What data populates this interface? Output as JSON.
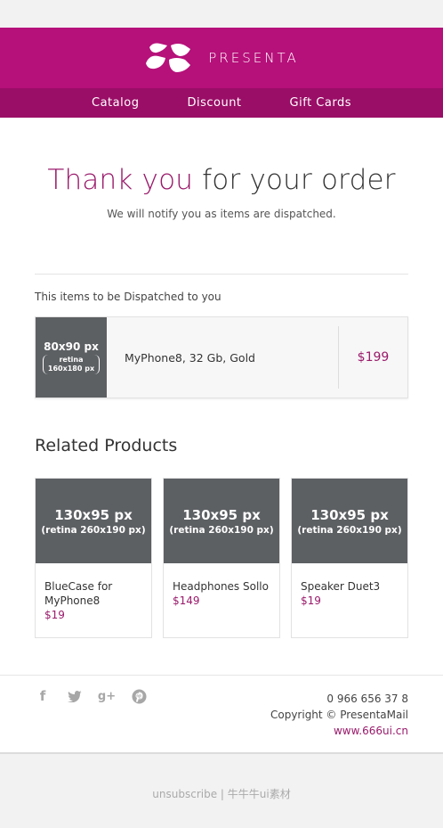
{
  "brand": {
    "name": "PRESENTA"
  },
  "nav": [
    "Catalog",
    "Discount",
    "Gift Cards"
  ],
  "hero": {
    "title_accent": "Thank you",
    "title_rest": " for your order",
    "subtitle": "We will notify you as items are dispatched."
  },
  "dispatch": {
    "title": "This items to be Dispatched to you",
    "item": {
      "thumb_big": "80x90 px",
      "thumb_small_1": "retina",
      "thumb_small_2": "160x180 px",
      "name": "MyPhone8, 32 Gb, Gold",
      "price": "$199"
    }
  },
  "related": {
    "title": "Related Products",
    "products": [
      {
        "img_big": "130x95 px",
        "img_small": "(retina 260x190 px)",
        "name": "BlueCase for MyPhone8",
        "price": "$19"
      },
      {
        "img_big": "130x95 px",
        "img_small": "(retina 260x190 px)",
        "name": "Headphones Sollo",
        "price": "$149"
      },
      {
        "img_big": "130x95 px",
        "img_small": "(retina 260x190 px)",
        "name": "Speaker Duet3",
        "price": "$19"
      }
    ]
  },
  "footer": {
    "socials": [
      "facebook-icon",
      "twitter-icon",
      "google-plus-icon",
      "pinterest-icon"
    ],
    "phone": "0 966 656 37 8",
    "copyright": "Copyright © PresentaMail",
    "website": "www.666ui.cn"
  },
  "bottom": {
    "text": "unsubscribe | 牛牛牛ui素材"
  },
  "colors": {
    "accent": "#b6107a",
    "nav": "#9a0e67",
    "price": "#9a1a6b",
    "placeholder": "#5d6063"
  }
}
